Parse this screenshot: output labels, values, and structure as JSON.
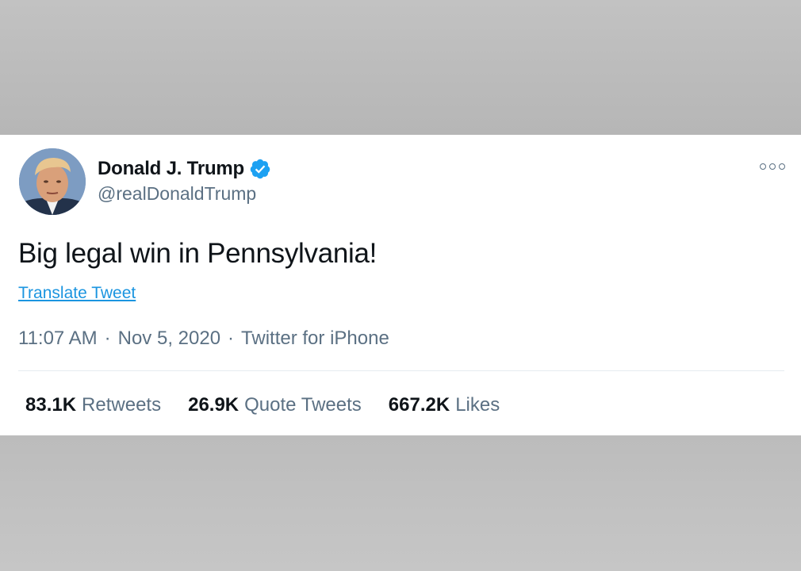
{
  "tweet": {
    "author": {
      "display_name": "Donald J. Trump",
      "handle": "@realDonaldTrump",
      "verified": true,
      "avatar_icon": "profile-photo"
    },
    "text": "Big legal win in Pennsylvania!",
    "translate_label": "Translate Tweet",
    "time": "11:07 AM",
    "date": "Nov 5, 2020",
    "source": "Twitter for iPhone",
    "separator": "·",
    "more_icon": "more-options-icon",
    "stats": [
      {
        "count": "83.1K",
        "label": "Retweets"
      },
      {
        "count": "26.9K",
        "label": "Quote Tweets"
      },
      {
        "count": "667.2K",
        "label": "Likes"
      }
    ]
  },
  "colors": {
    "link": "#1b95e0",
    "verified": "#1da1f2",
    "secondary_text": "#5b7083",
    "primary_text": "#0f1419",
    "background": "#bdbdbd"
  }
}
